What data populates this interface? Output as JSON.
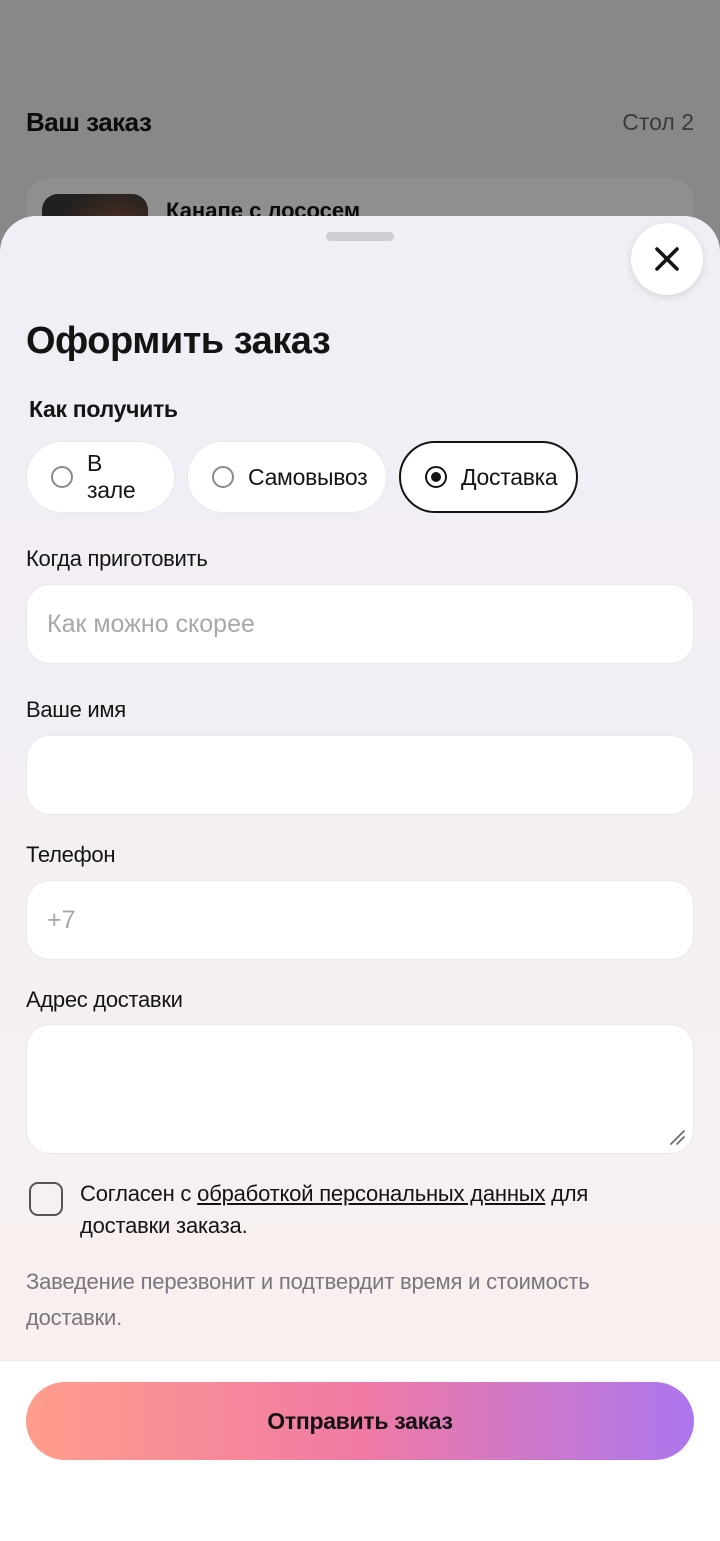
{
  "background": {
    "title": "Ваш заказ",
    "table": "Стол 2",
    "item_title": "Канапе с лососем"
  },
  "sheet": {
    "title": "Оформить заказ",
    "receive_label": "Как получить",
    "options": [
      {
        "label": "В зале",
        "selected": false
      },
      {
        "label": "Самовывоз",
        "selected": false
      },
      {
        "label": "Доставка",
        "selected": true
      }
    ],
    "when": {
      "label": "Когда приготовить",
      "placeholder": "Как можно скорее"
    },
    "name": {
      "label": "Ваше имя",
      "placeholder": ""
    },
    "phone": {
      "label": "Телефон",
      "placeholder": "+7"
    },
    "address": {
      "label": "Адрес доставки",
      "placeholder": ""
    },
    "consent": {
      "prefix": "Согласен с ",
      "link": "обработкой персональных данных",
      "suffix": " для доставки заказа.",
      "checked": false
    },
    "note": "Заведение перезвонит и подтвердит время и стоимость доставки.",
    "submit_label": "Отправить заказ"
  },
  "colors": {
    "gradient_start": "#ff9d8c",
    "gradient_mid": "#f07aa4",
    "gradient_end": "#ad76ee",
    "text": "#141414"
  },
  "icons": {
    "close": "close-icon",
    "resize": "resize-handle-icon"
  }
}
